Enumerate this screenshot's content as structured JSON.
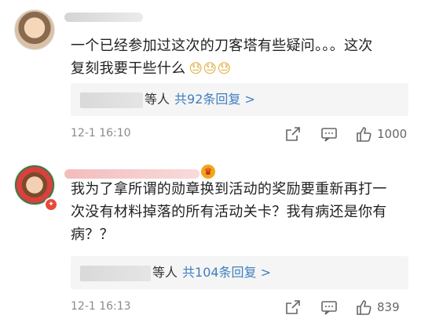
{
  "comments": [
    {
      "text_line1": "一个已经参加过这次的刀客塔有些疑问。。。这次",
      "text_line2": "复刻我要干些什么",
      "emoji": "😓😓😓",
      "reply": {
        "others": "等人",
        "link": "共92条回复 >"
      },
      "timestamp": "12-1 16:10",
      "likes": "1000"
    },
    {
      "text_line1": "我为了拿所谓的勋章换到活动的奖励要重新再打一",
      "text_line2": "次没有材料掉落的所有活动关卡？我有病还是你有",
      "text_line3": "病？？",
      "reply": {
        "others": "等人",
        "link": "共104条回复 >"
      },
      "timestamp": "12-1 16:13",
      "likes": "839"
    }
  ],
  "icons": {
    "share": "share-icon",
    "reply": "comment-icon",
    "like": "thumbs-up-icon"
  },
  "colors": {
    "link": "#3f7fc1",
    "text": "#222222",
    "meta": "#8a8a8a",
    "reply_bg": "#f5f5f5"
  }
}
